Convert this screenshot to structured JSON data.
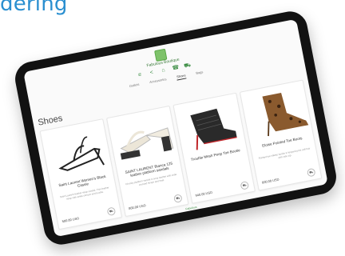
{
  "heading": "dering",
  "store": {
    "brand": "Fabulous Boutique",
    "nav": [
      "Outlets",
      "Accessories",
      "Shoes",
      "Bags"
    ],
    "active_nav": "Shoes"
  },
  "section_title": "Shoes",
  "products": [
    {
      "name": "Saint Laurent Women's Black Cassie",
      "desc": "Saint Laurent leather strap sandal. Thin leather strap with ankle closure and buckle.",
      "price": "500.00 USD"
    },
    {
      "name": "SAINT LAURENT Bianca 125 leather platform sandals",
      "desc": "Chunky platform sandal in ivory leather with wide crossed straps and heel.",
      "price": "800.00 USD"
    },
    {
      "name": "Trouble Mesh Peep Toe Bootie",
      "desc": "",
      "price": "940.00 USD"
    },
    {
      "name": "Eloise Pointed Toe Boots",
      "desc": "Pointed toe stiletto bootie in leopard print calf hair with side zip.",
      "price": "600.00 USD"
    }
  ],
  "footer": "Fabulous"
}
